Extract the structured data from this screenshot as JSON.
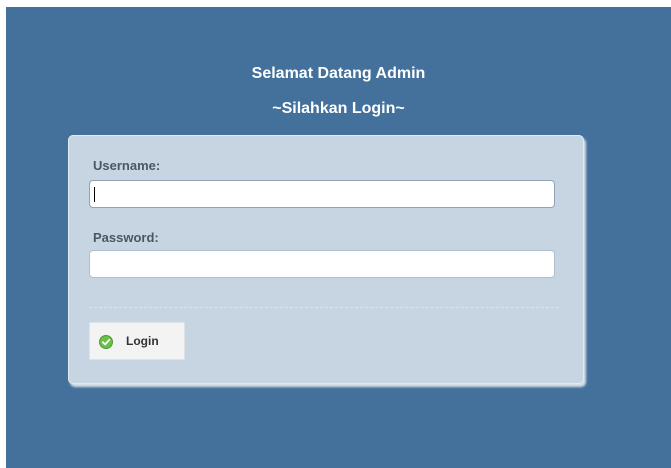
{
  "header": {
    "welcome": "Selamat Datang Admin",
    "subtitle": "~Silahkan Login~"
  },
  "form": {
    "username_label": "Username:",
    "username_value": "",
    "password_label": "Password:",
    "password_value": "",
    "login_label": "Login",
    "login_icon": "check-circle-icon"
  },
  "colors": {
    "background": "#43719c",
    "panel": "#c7d5e2",
    "label_text": "#4b5763",
    "icon_green": "#6cc04a"
  }
}
